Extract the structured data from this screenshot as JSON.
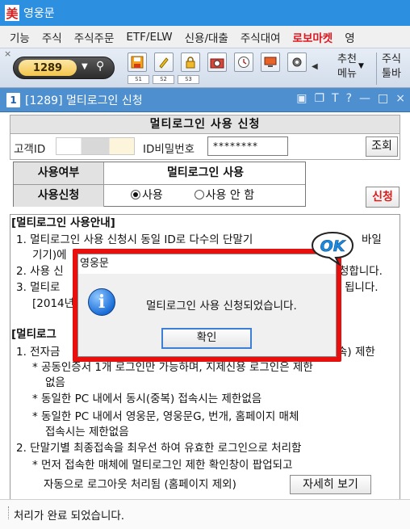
{
  "app": {
    "title": "영웅문",
    "logo_char": "美"
  },
  "menu": {
    "items": [
      "기능",
      "주식",
      "주식주문",
      "ETF/ELW",
      "신용/대출",
      "주식대여"
    ],
    "highlight": "로보마켓",
    "trailing": "영"
  },
  "toolbar": {
    "close_glyph": "×",
    "screen_number": "1289",
    "slots": [
      "S1",
      "S2",
      "S3"
    ],
    "recommend_label_1": "추천",
    "recommend_label_2": "메뉴",
    "stock_label_1": "주식",
    "stock_label_2": "툴바"
  },
  "window": {
    "index": "1",
    "title": "[1289] 멀티로그인 신청"
  },
  "form": {
    "title": "멀티로그인 사용 신청",
    "customer_id_label": "고객ID",
    "id_password_label": "ID비밀번호",
    "password_value": "********",
    "lookup_button": "조회",
    "usage_label": "사용여부",
    "usage_value": "멀티로그인 사용",
    "apply_label": "사용신청",
    "option_use": "사용",
    "option_no_use": "사용 안 함",
    "apply_button": "신청"
  },
  "guide": {
    "heading1": "[멀티로그인 사용안내]",
    "line1a": "1. 멀티로그인 사용 신청시 동일 ID로 다수의 단말기",
    "line1a_tail": "바일",
    "line1b": "기기)에",
    "line2": "2. 사용 신",
    "line2_tail": "청합니다.",
    "line3": "3. 멀티로",
    "line3_tail": "됩니다.",
    "line3b": "[2014년",
    "heading2": "[멀티로그",
    "line4": "1. 전자금",
    "line4_tail": "속) 제한",
    "sub1a": "* 공동인증서 1개 로그인만 가능하며, 지제신용 로그인은 제한",
    "sub1b": "없음",
    "sub2": "* 동일한 PC 내에서 동시(중복) 접속시는 제한없음",
    "sub3a": "* 동일한 PC 내에서 영웅문, 영웅문G, 번개, 홈페이지 매체",
    "sub3b": "접속시는 제한없음",
    "line5": "2. 단말기별 최종접속을 최우선 하여 유효한 로그인으로 처리함",
    "sub4": "* 먼저 접속한 매체에 멀티로그인 제한 확인창이 팝업되고",
    "sub5": "자동으로 로그아웃 처리됨 (홈페이지 제외)",
    "detail_button": "자세히 보기"
  },
  "status": {
    "text": "처리가 완료 되었습니다."
  },
  "dialog": {
    "title": "영웅문",
    "icon_char": "i",
    "message": "멀티로그인 사용 신청되었습니다.",
    "ok_button": "확인",
    "badge": "OK"
  },
  "colors": {
    "titlebar": "#2d8fe0",
    "highlight_menu": "#e0161e",
    "dialog_frame": "#e7100f",
    "ok_badge": "#1a8be0"
  }
}
